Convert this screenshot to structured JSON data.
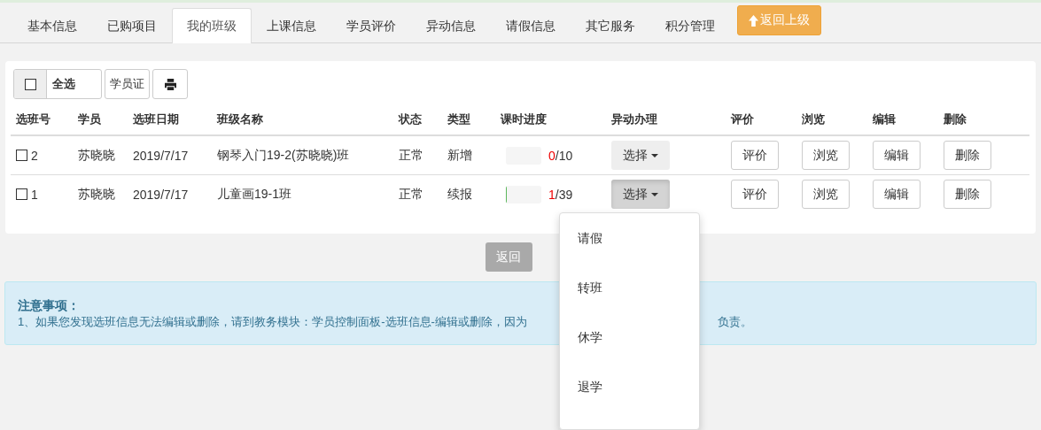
{
  "tabs": [
    {
      "label": "基本信息",
      "selected": false
    },
    {
      "label": "已购项目",
      "selected": false
    },
    {
      "label": "我的班级",
      "selected": true
    },
    {
      "label": "上课信息",
      "selected": false
    },
    {
      "label": "学员评价",
      "selected": false
    },
    {
      "label": "异动信息",
      "selected": false
    },
    {
      "label": "请假信息",
      "selected": false
    },
    {
      "label": "其它服务",
      "selected": false
    },
    {
      "label": "积分管理",
      "selected": false
    }
  ],
  "back_up_button": "返回上级",
  "toolbar": {
    "select_all": {
      "label": "全选",
      "checked": false
    },
    "card_button": "学员证"
  },
  "table": {
    "columns": [
      "选班号",
      "学员",
      "选班日期",
      "班级名称",
      "状态",
      "类型",
      "课时进度",
      "异动办理",
      "评价",
      "浏览",
      "编辑",
      "删除"
    ],
    "rows": [
      {
        "checked": false,
        "number": "2",
        "student": "苏晓晓",
        "date": "2019/7/17",
        "class_name": "钢琴入门19-2(苏晓晓)班",
        "status": "正常",
        "type": "新增",
        "level": 0,
        "done": "0",
        "total": "/10",
        "change_button": "选择",
        "menu_open": false,
        "rate": "评价",
        "browse": "浏览",
        "edit": "编辑",
        "delete": "删除"
      },
      {
        "checked": false,
        "number": "1",
        "student": "苏晓晓",
        "date": "2019/7/17",
        "class_name": "儿童画19-1班",
        "status": "正常",
        "type": "续报",
        "level": 0.03,
        "done": "1",
        "total": "/39",
        "change_button": "选择",
        "menu_open": true,
        "rate": "评价",
        "browse": "浏览",
        "edit": "编辑",
        "delete": "删除"
      }
    ]
  },
  "change_menu": {
    "items": [
      "请假",
      "转班",
      "休学",
      "退学"
    ]
  },
  "return_button": {
    "label": "返回",
    "disabled": true
  },
  "notice": {
    "title": "注意事项：",
    "text_start": "1、如果您发现选班信息无法编辑或删除，请到教务模块：学员控制面板-选班信息-编辑或删除，因为",
    "text_end": "负责。"
  }
}
